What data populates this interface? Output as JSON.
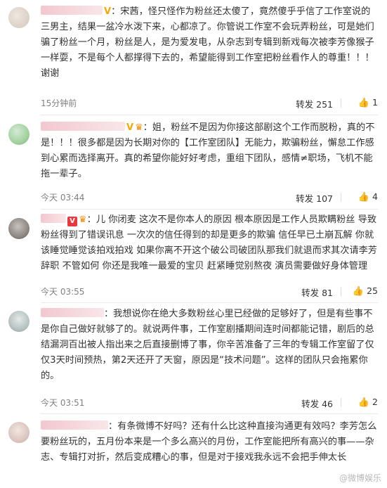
{
  "comments": [
    {
      "text": "：宋茜，怪只怪作为粉丝还太傻了，竟然傻乎乎信了工作室说的三男主，结果一盆冷水泼下来，心都凉了。你管说工作室不会玩弄粉丝，可是她们骗了粉丝一个月，粉丝是人，是为爱发电，从杂志到专辑到新戏每次被李芳像猴子一样耍，不是每个人都撑得下去的，希望能得到工作室把粉丝看作人的尊重！！！谢谢",
      "time": "15分钟前",
      "repost": "转发 251",
      "likes": "1"
    },
    {
      "text": "：姐，粉丝不是因为你接这部剧这个工作而脱粉，真的不是！！！很多都是因为长期对你的【工作室团队】无能力，欺骗粉丝，懈怠工作感到心累而选择离开。真的希望你能好好考虑，重组下团队，感情≠职场，飞机不能拖一辈子。",
      "time": "今天 03:44",
      "repost": "转发 107",
      "likes": "4"
    },
    {
      "text": "：儿 你闭麦 这次不是你本人的原因 根本原因是工作人员欺瞒粉丝 导致粉丝得到了错误讯息 一次次的信任得到的却是更多的欺骗 信任早已土崩瓦解 你就该睡觉睡觉该拍戏拍戏 如果你离不开这个破公司破团队那我们就退而求其次请李芳辞职 不管如何 你还是我唯一最爱的宝贝 赶紧睡觉别熬夜 演员需要做好身体管理",
      "time": "今天 03:55",
      "repost": "转发 81",
      "likes": "25"
    },
    {
      "text": "：我想说你在绝大多数粉丝心里已经做的足够好了，但是有些事不是你自己做好就够了的。就说两件事，工作室剧播期间连时间都能记错，剧后的总结漏洞百出被人指出来之后直接删博了事，你辛苦准备了三年的专辑工作室留了仅仅3天时间预热，第2天还开了天窗，原因是“技术问题”。这样的团队只会拖累你的。",
      "time": "今天 03:51",
      "repost": "转发 46",
      "likes": "2"
    },
    {
      "text": "：有条微博不好吗？还有什么比这种直接沟通更有效吗？李芳怎么要粉丝玩的，五月份本来是一个多么高兴的月份，工作室能把所有高兴的事——杂志、专辑打对折，然后变成糟心的事，但是对于接戏我永远不会把手伸太长"
    }
  ],
  "watermark": "@微博娱乐",
  "icons": {
    "like": "thumbs-up-icon",
    "verified": "verified-v-icon",
    "badge": "fan-badge-icon",
    "crown": "crown-icon"
  }
}
